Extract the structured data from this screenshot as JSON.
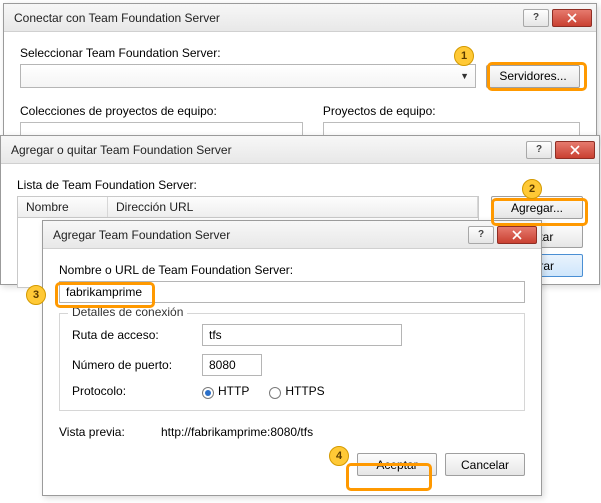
{
  "dialog1": {
    "title": "Conectar con Team Foundation Server",
    "select_label": "Seleccionar Team Foundation Server:",
    "servers_btn": "Servidores...",
    "collections_label": "Colecciones de proyectos de equipo:",
    "projects_label": "Proyectos de equipo:"
  },
  "dialog2": {
    "title": "Agregar o quitar Team Foundation Server",
    "list_label": "Lista de Team Foundation Server:",
    "col_name": "Nombre",
    "col_url": "Dirección URL",
    "add_btn": "Agregar...",
    "remove_btn": "Quitar",
    "close_btn": "Cerrar"
  },
  "dialog3": {
    "title": "Agregar Team Foundation Server",
    "name_label": "Nombre o URL de Team Foundation Server:",
    "name_value": "fabrikamprime",
    "details_legend": "Detalles de conexión",
    "path_label": "Ruta de acceso:",
    "path_value": "tfs",
    "port_label": "Número de puerto:",
    "port_value": "8080",
    "protocol_label": "Protocolo:",
    "protocol_http": "HTTP",
    "protocol_https": "HTTPS",
    "preview_label": "Vista previa:",
    "preview_value": "http://fabrikamprime:8080/tfs",
    "ok_btn": "Aceptar",
    "cancel_btn": "Cancelar"
  },
  "callouts": {
    "c1": "1",
    "c2": "2",
    "c3": "3",
    "c4": "4"
  }
}
